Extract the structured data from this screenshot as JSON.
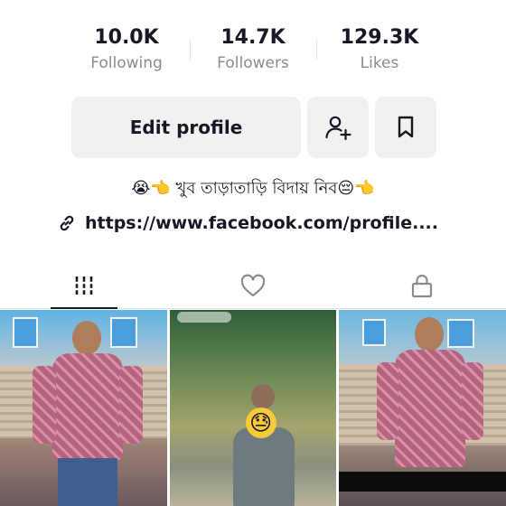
{
  "stats": {
    "following": {
      "value": "10.0K",
      "label": "Following"
    },
    "followers": {
      "value": "14.7K",
      "label": "Followers"
    },
    "likes": {
      "value": "129.3K",
      "label": "Likes"
    }
  },
  "actions": {
    "edit_label": "Edit profile",
    "add_friend_icon": "add-person-icon",
    "favorites_icon": "bookmark-icon"
  },
  "bio": {
    "text": "😭👈 খুব তাড়াতাড়ি বিদায় নিব😔👈"
  },
  "link": {
    "text": "https://www.facebook.com/profile...."
  },
  "tabs": [
    {
      "name": "videos",
      "icon": "grid-bars-icon",
      "active": true
    },
    {
      "name": "liked",
      "icon": "heart-icon",
      "active": false
    },
    {
      "name": "private",
      "icon": "lock-icon",
      "active": false
    }
  ],
  "videos": [
    {
      "thumbnail": "person-pink-shirt"
    },
    {
      "thumbnail": "person-outdoor-emoji-face",
      "emoji": "😓"
    },
    {
      "thumbnail": "person-pink-shirt-steps"
    }
  ],
  "colors": {
    "text": "#161823",
    "secondary_text": "#8a8b91",
    "button_bg": "#f1f1f2"
  }
}
